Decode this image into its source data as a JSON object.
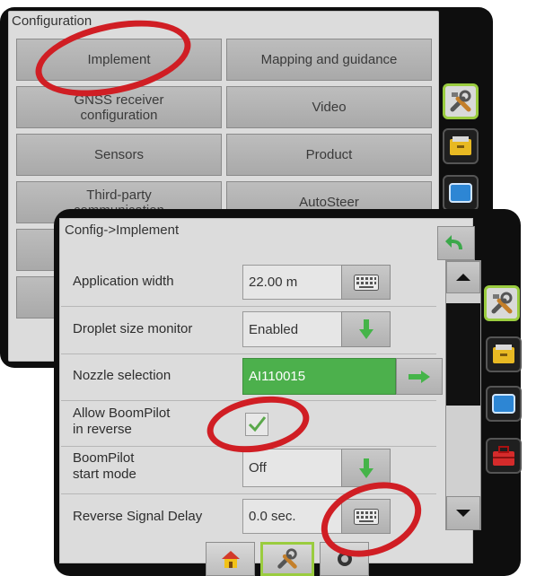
{
  "config_window": {
    "title": "Configuration",
    "buttons": [
      {
        "label": "Implement"
      },
      {
        "label": "Mapping and guidance"
      },
      {
        "label_line1": "GNSS receiver",
        "label_line2": "configuration"
      },
      {
        "label": "Video"
      },
      {
        "label": "Sensors"
      },
      {
        "label": "Product"
      },
      {
        "label_line1": "Third-party",
        "label_line2": "communication"
      },
      {
        "label": "AutoSteer"
      }
    ]
  },
  "implement_window": {
    "title": "Config->Implement",
    "rows": [
      {
        "label": "Application width",
        "value": "22.00 m",
        "action_icon": "keyboard-icon"
      },
      {
        "label": "Droplet size monitor",
        "value": "Enabled",
        "action_icon": "green-down-arrow-icon"
      },
      {
        "label": "Nozzle selection",
        "value": "AI110015",
        "action_icon": "green-right-arrow-icon"
      },
      {
        "label_line1": "Allow BoomPilot",
        "label_line2": "in reverse",
        "checked": true
      },
      {
        "label_line1": "BoomPilot",
        "label_line2": "start mode",
        "value": "Off",
        "action_icon": "green-down-arrow-icon"
      },
      {
        "label": "Reverse Signal Delay",
        "value": "0.0 sec.",
        "action_icon": "keyboard-icon"
      }
    ]
  },
  "side_toolbar": {
    "items": [
      "tools-icon",
      "console-icon",
      "display-icon",
      "toolbox-icon"
    ],
    "active": "tools-icon"
  },
  "bottom_bar": {
    "tabs": [
      "home-icon",
      "tools-icon",
      "guidance-icon"
    ],
    "active": "tools-icon"
  },
  "colors": {
    "highlight_ring": "#d01e24",
    "active_border": "#9acc3f",
    "green_field": "#4cb04c",
    "window_frame": "#0e0e0e"
  }
}
